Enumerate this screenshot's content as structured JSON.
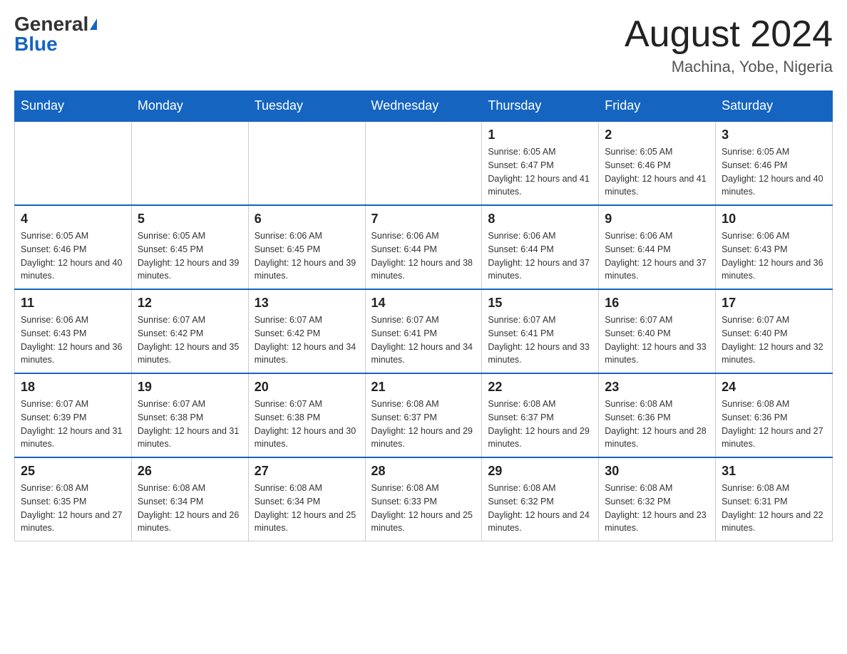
{
  "header": {
    "logo_general": "General",
    "logo_blue": "Blue",
    "month_title": "August 2024",
    "location": "Machina, Yobe, Nigeria"
  },
  "days_of_week": [
    "Sunday",
    "Monday",
    "Tuesday",
    "Wednesday",
    "Thursday",
    "Friday",
    "Saturday"
  ],
  "weeks": [
    [
      {
        "day": "",
        "sunrise": "",
        "sunset": "",
        "daylight": ""
      },
      {
        "day": "",
        "sunrise": "",
        "sunset": "",
        "daylight": ""
      },
      {
        "day": "",
        "sunrise": "",
        "sunset": "",
        "daylight": ""
      },
      {
        "day": "",
        "sunrise": "",
        "sunset": "",
        "daylight": ""
      },
      {
        "day": "1",
        "sunrise": "Sunrise: 6:05 AM",
        "sunset": "Sunset: 6:47 PM",
        "daylight": "Daylight: 12 hours and 41 minutes."
      },
      {
        "day": "2",
        "sunrise": "Sunrise: 6:05 AM",
        "sunset": "Sunset: 6:46 PM",
        "daylight": "Daylight: 12 hours and 41 minutes."
      },
      {
        "day": "3",
        "sunrise": "Sunrise: 6:05 AM",
        "sunset": "Sunset: 6:46 PM",
        "daylight": "Daylight: 12 hours and 40 minutes."
      }
    ],
    [
      {
        "day": "4",
        "sunrise": "Sunrise: 6:05 AM",
        "sunset": "Sunset: 6:46 PM",
        "daylight": "Daylight: 12 hours and 40 minutes."
      },
      {
        "day": "5",
        "sunrise": "Sunrise: 6:05 AM",
        "sunset": "Sunset: 6:45 PM",
        "daylight": "Daylight: 12 hours and 39 minutes."
      },
      {
        "day": "6",
        "sunrise": "Sunrise: 6:06 AM",
        "sunset": "Sunset: 6:45 PM",
        "daylight": "Daylight: 12 hours and 39 minutes."
      },
      {
        "day": "7",
        "sunrise": "Sunrise: 6:06 AM",
        "sunset": "Sunset: 6:44 PM",
        "daylight": "Daylight: 12 hours and 38 minutes."
      },
      {
        "day": "8",
        "sunrise": "Sunrise: 6:06 AM",
        "sunset": "Sunset: 6:44 PM",
        "daylight": "Daylight: 12 hours and 37 minutes."
      },
      {
        "day": "9",
        "sunrise": "Sunrise: 6:06 AM",
        "sunset": "Sunset: 6:44 PM",
        "daylight": "Daylight: 12 hours and 37 minutes."
      },
      {
        "day": "10",
        "sunrise": "Sunrise: 6:06 AM",
        "sunset": "Sunset: 6:43 PM",
        "daylight": "Daylight: 12 hours and 36 minutes."
      }
    ],
    [
      {
        "day": "11",
        "sunrise": "Sunrise: 6:06 AM",
        "sunset": "Sunset: 6:43 PM",
        "daylight": "Daylight: 12 hours and 36 minutes."
      },
      {
        "day": "12",
        "sunrise": "Sunrise: 6:07 AM",
        "sunset": "Sunset: 6:42 PM",
        "daylight": "Daylight: 12 hours and 35 minutes."
      },
      {
        "day": "13",
        "sunrise": "Sunrise: 6:07 AM",
        "sunset": "Sunset: 6:42 PM",
        "daylight": "Daylight: 12 hours and 34 minutes."
      },
      {
        "day": "14",
        "sunrise": "Sunrise: 6:07 AM",
        "sunset": "Sunset: 6:41 PM",
        "daylight": "Daylight: 12 hours and 34 minutes."
      },
      {
        "day": "15",
        "sunrise": "Sunrise: 6:07 AM",
        "sunset": "Sunset: 6:41 PM",
        "daylight": "Daylight: 12 hours and 33 minutes."
      },
      {
        "day": "16",
        "sunrise": "Sunrise: 6:07 AM",
        "sunset": "Sunset: 6:40 PM",
        "daylight": "Daylight: 12 hours and 33 minutes."
      },
      {
        "day": "17",
        "sunrise": "Sunrise: 6:07 AM",
        "sunset": "Sunset: 6:40 PM",
        "daylight": "Daylight: 12 hours and 32 minutes."
      }
    ],
    [
      {
        "day": "18",
        "sunrise": "Sunrise: 6:07 AM",
        "sunset": "Sunset: 6:39 PM",
        "daylight": "Daylight: 12 hours and 31 minutes."
      },
      {
        "day": "19",
        "sunrise": "Sunrise: 6:07 AM",
        "sunset": "Sunset: 6:38 PM",
        "daylight": "Daylight: 12 hours and 31 minutes."
      },
      {
        "day": "20",
        "sunrise": "Sunrise: 6:07 AM",
        "sunset": "Sunset: 6:38 PM",
        "daylight": "Daylight: 12 hours and 30 minutes."
      },
      {
        "day": "21",
        "sunrise": "Sunrise: 6:08 AM",
        "sunset": "Sunset: 6:37 PM",
        "daylight": "Daylight: 12 hours and 29 minutes."
      },
      {
        "day": "22",
        "sunrise": "Sunrise: 6:08 AM",
        "sunset": "Sunset: 6:37 PM",
        "daylight": "Daylight: 12 hours and 29 minutes."
      },
      {
        "day": "23",
        "sunrise": "Sunrise: 6:08 AM",
        "sunset": "Sunset: 6:36 PM",
        "daylight": "Daylight: 12 hours and 28 minutes."
      },
      {
        "day": "24",
        "sunrise": "Sunrise: 6:08 AM",
        "sunset": "Sunset: 6:36 PM",
        "daylight": "Daylight: 12 hours and 27 minutes."
      }
    ],
    [
      {
        "day": "25",
        "sunrise": "Sunrise: 6:08 AM",
        "sunset": "Sunset: 6:35 PM",
        "daylight": "Daylight: 12 hours and 27 minutes."
      },
      {
        "day": "26",
        "sunrise": "Sunrise: 6:08 AM",
        "sunset": "Sunset: 6:34 PM",
        "daylight": "Daylight: 12 hours and 26 minutes."
      },
      {
        "day": "27",
        "sunrise": "Sunrise: 6:08 AM",
        "sunset": "Sunset: 6:34 PM",
        "daylight": "Daylight: 12 hours and 25 minutes."
      },
      {
        "day": "28",
        "sunrise": "Sunrise: 6:08 AM",
        "sunset": "Sunset: 6:33 PM",
        "daylight": "Daylight: 12 hours and 25 minutes."
      },
      {
        "day": "29",
        "sunrise": "Sunrise: 6:08 AM",
        "sunset": "Sunset: 6:32 PM",
        "daylight": "Daylight: 12 hours and 24 minutes."
      },
      {
        "day": "30",
        "sunrise": "Sunrise: 6:08 AM",
        "sunset": "Sunset: 6:32 PM",
        "daylight": "Daylight: 12 hours and 23 minutes."
      },
      {
        "day": "31",
        "sunrise": "Sunrise: 6:08 AM",
        "sunset": "Sunset: 6:31 PM",
        "daylight": "Daylight: 12 hours and 22 minutes."
      }
    ]
  ]
}
